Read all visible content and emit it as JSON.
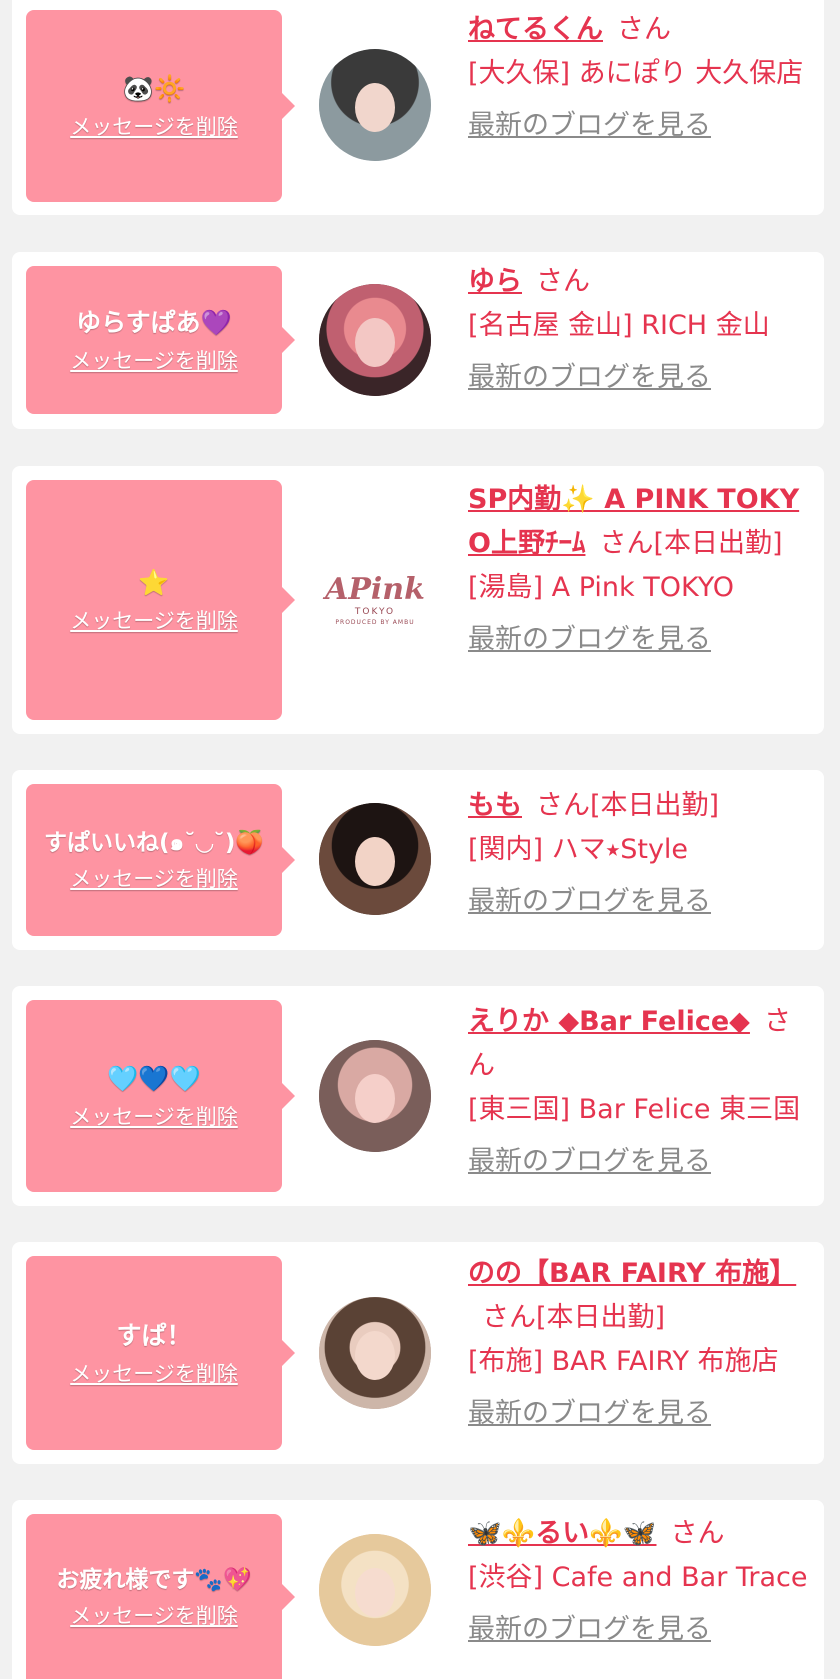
{
  "common": {
    "delete_label": "メッセージを削除",
    "blog_label": "最新のブログを見る",
    "san_label": "さん"
  },
  "entries": [
    {
      "message": "🐼🔆",
      "name": "ねてるくん",
      "status": "",
      "shop": "[大久保] あにぽり 大久保店"
    },
    {
      "message": "ゆらすぱあ💜",
      "name": "ゆら",
      "status": "",
      "shop": "[名古屋 金山] RICH 金山"
    },
    {
      "message": "⭐",
      "name": "SP内勤✨ A PINK TOKYO上野ﾁｰﾑ",
      "status": "[本日出勤]",
      "shop": "[湯島] A Pink TOKYO",
      "logo": {
        "big": "APink",
        "small": "TOKYO",
        "tiny": "PRODUCED BY AMBU"
      }
    },
    {
      "message": "すぱいいね(๑˘◡˘)🍑",
      "name": "もも",
      "status": "[本日出勤]",
      "shop": "[関内] ハマ⭑Style"
    },
    {
      "message": "🩵💙🩵",
      "name": "えりか ◆Bar Felice◆",
      "status": "",
      "shop": "[東三国] Bar Felice 東三国"
    },
    {
      "message": "すぱ！",
      "name": "のの【BAR FAIRY 布施】",
      "status": "[本日出勤]",
      "shop": "[布施] BAR FAIRY 布施店"
    },
    {
      "message": "お疲れ様です🐾💖",
      "name": "🦋⚜️るい⚜️🦋",
      "status": "",
      "shop": "[渋谷] Cafe and Bar Trace"
    }
  ]
}
